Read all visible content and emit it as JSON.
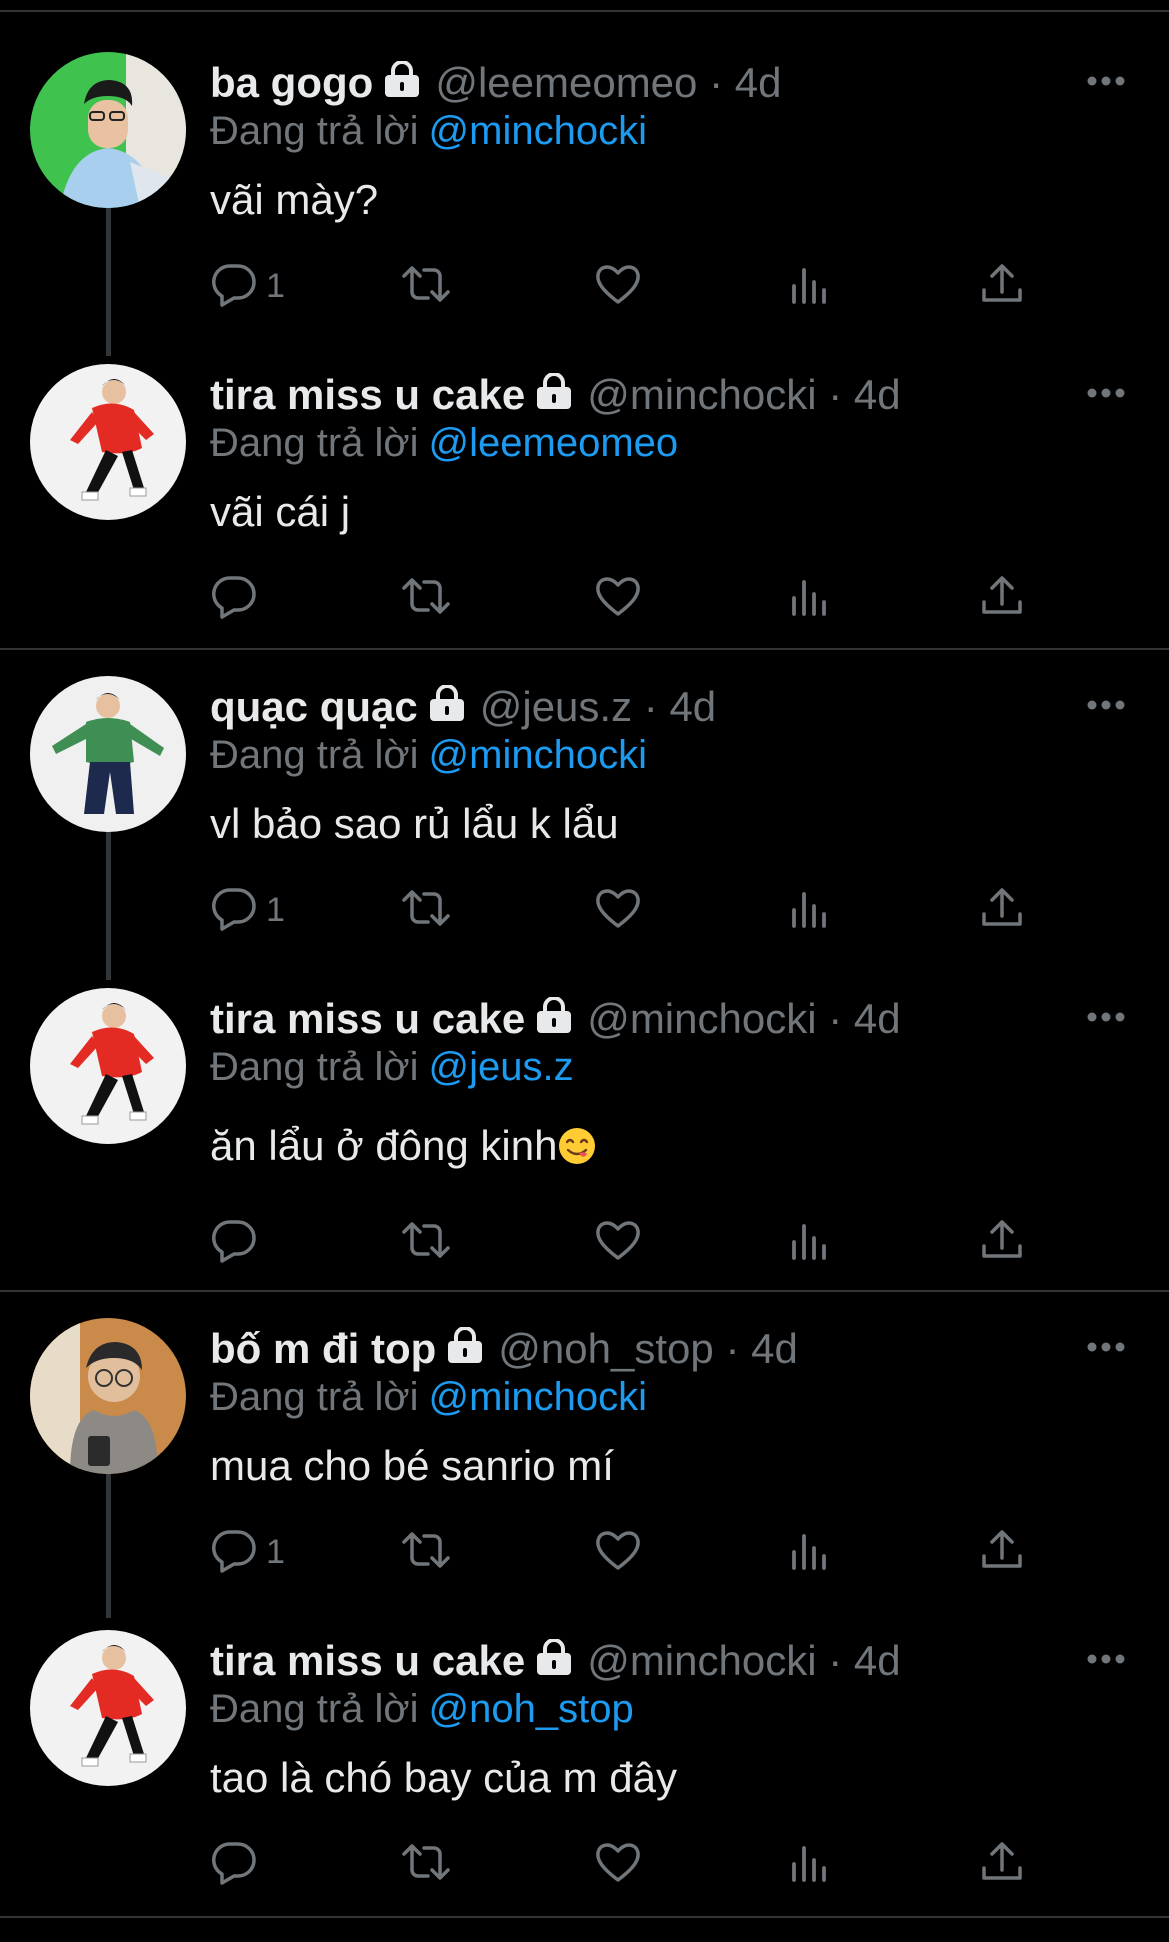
{
  "tweets": [
    {
      "name": "ba gogo",
      "handle": "@leemeomeo",
      "dot": "·",
      "time": "4d",
      "replying_label": "Đang trả lời",
      "replying_to": "@minchocki",
      "text": "vãi mày?",
      "reply_count": "1",
      "avatar_bg": "#35c24a"
    },
    {
      "name": "tira miss u cake",
      "handle": "@minchocki",
      "dot": "·",
      "time": "4d",
      "replying_label": "Đang trả lời",
      "replying_to": "@leemeomeo",
      "text": "vãi cái j",
      "reply_count": "",
      "avatar_bg": "#f2f2f2"
    },
    {
      "name": "quạc quạc",
      "handle": "@jeus.z",
      "dot": "·",
      "time": "4d",
      "replying_label": "Đang trả lời",
      "replying_to": "@minchocki",
      "text": "vl bảo sao rủ lẩu k lẩu",
      "reply_count": "1",
      "avatar_bg": "#f0f0f0"
    },
    {
      "name": "tira miss u cake",
      "handle": "@minchocki",
      "dot": "·",
      "time": "4d",
      "replying_label": "Đang trả lời",
      "replying_to": "@jeus.z",
      "text": "ăn lẩu ở đông kinh",
      "reply_count": "",
      "avatar_bg": "#f2f2f2",
      "emoji": "face-savoring-food"
    },
    {
      "name": "bố m đi top",
      "handle": "@noh_stop",
      "dot": "·",
      "time": "4d",
      "replying_label": "Đang trả lời",
      "replying_to": "@minchocki",
      "text": "mua cho bé sanrio mí",
      "reply_count": "1",
      "avatar_bg": "#c98a4a"
    },
    {
      "name": "tira miss u cake",
      "handle": "@minchocki",
      "dot": "·",
      "time": "4d",
      "replying_label": "Đang trả lời",
      "replying_to": "@noh_stop",
      "text": "tao là chó bay của m đây",
      "reply_count": "",
      "avatar_bg": "#f2f2f2"
    }
  ],
  "icons": [
    "lock-icon",
    "more-icon",
    "reply-icon",
    "retweet-icon",
    "like-icon",
    "views-icon",
    "share-icon"
  ],
  "colors": {
    "background": "#000000",
    "link": "#1d9bf0",
    "muted": "#71767b",
    "text": "#e7e9ea",
    "divider": "#2f3336"
  }
}
